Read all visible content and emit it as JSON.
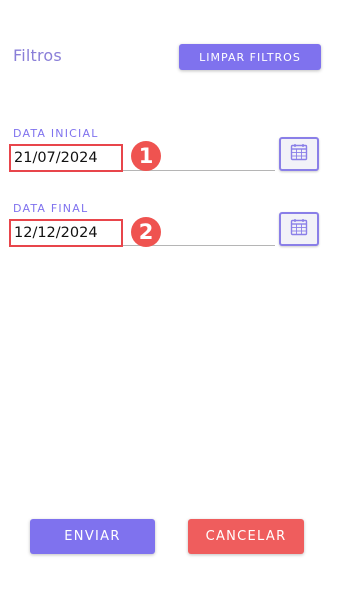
{
  "header": {
    "title": "Filtros",
    "clear_button_label": "LIMPAR FILTROS"
  },
  "fields": [
    {
      "label": "DATA INICIAL",
      "value": "21/07/2024",
      "marker": "1",
      "calendar_icon": "calendar-icon"
    },
    {
      "label": "DATA FINAL",
      "value": "12/12/2024",
      "marker": "2",
      "calendar_icon": "calendar-icon"
    }
  ],
  "actions": {
    "send_label": "ENVIAR",
    "cancel_label": "CANCELAR"
  },
  "colors": {
    "primary": "#7f72ee",
    "danger": "#ef5d5d",
    "annotation": "#e8454b"
  }
}
